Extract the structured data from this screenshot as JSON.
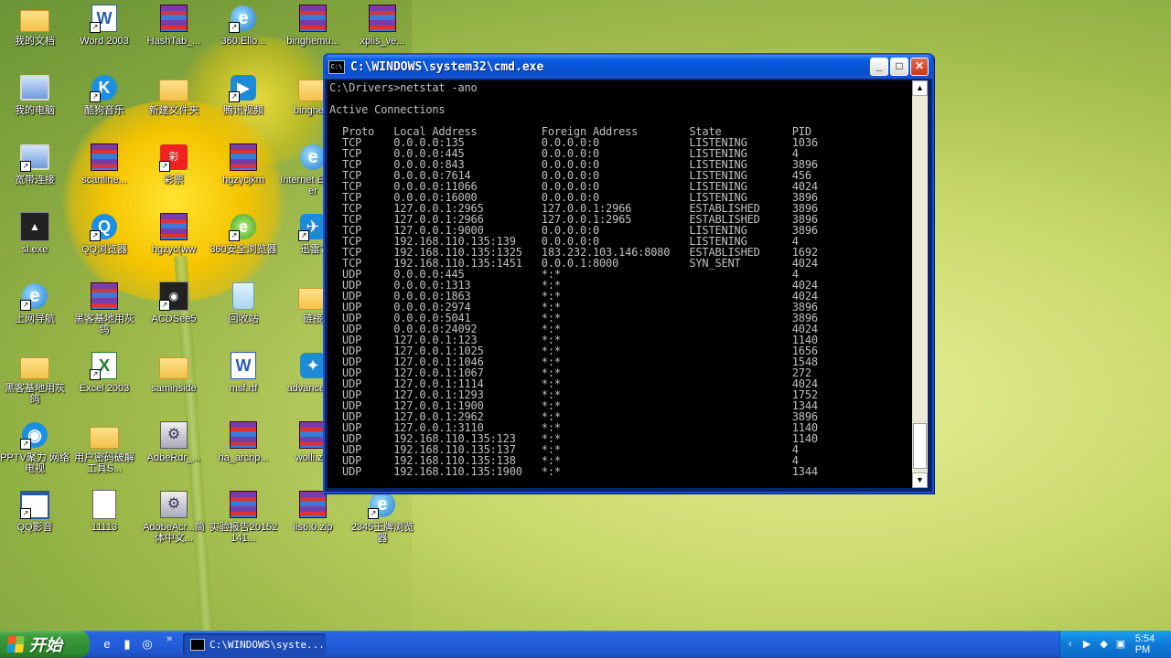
{
  "desktop_icons": [
    {
      "label": "我的文档",
      "icon": "folder-icon",
      "shortcut": false
    },
    {
      "label": "Word 2003",
      "icon": "word-icon",
      "shortcut": true
    },
    {
      "label": "HashTab_...",
      "icon": "archive-icon",
      "shortcut": false
    },
    {
      "label": "360.Ello...",
      "icon": "ie-icon",
      "shortcut": true
    },
    {
      "label": "binghemu...",
      "icon": "archive-icon",
      "shortcut": false
    },
    {
      "label": "xpiis_ve...",
      "icon": "archive-icon",
      "shortcut": false
    },
    {
      "label": "我的电脑",
      "icon": "computer-icon",
      "shortcut": false
    },
    {
      "label": "酷狗音乐",
      "icon": "kugou-icon",
      "shortcut": true
    },
    {
      "label": "新建文件夹",
      "icon": "folder-icon",
      "shortcut": false
    },
    {
      "label": "腾讯视频",
      "icon": "video-icon",
      "shortcut": true
    },
    {
      "label": "binghem",
      "icon": "folder-icon",
      "shortcut": false
    },
    {
      "label": "网上邻居",
      "icon": "network-icon",
      "shortcut": false
    },
    {
      "label": "宽带连接",
      "icon": "broadband-icon",
      "shortcut": true
    },
    {
      "label": "scanline...",
      "icon": "archive-icon",
      "shortcut": false
    },
    {
      "label": "彩票",
      "icon": "lottery-icon",
      "shortcut": true
    },
    {
      "label": "hgzycjkm",
      "icon": "archive-icon",
      "shortcut": false
    },
    {
      "label": "Internet Explorer",
      "icon": "ie-icon",
      "shortcut": false
    },
    {
      "label": "腾讯QQ",
      "icon": "qq-icon",
      "shortcut": true
    },
    {
      "label": "sl.exe",
      "icon": "exe-icon",
      "shortcut": false
    },
    {
      "label": "QQ浏览器",
      "icon": "browser-icon",
      "shortcut": true
    },
    {
      "label": "hgzyc(ww",
      "icon": "archive-icon",
      "shortcut": false
    },
    {
      "label": "360安全浏览器",
      "icon": "browser-360-icon",
      "shortcut": true
    },
    {
      "label": "迅雷7",
      "icon": "thunder-icon",
      "shortcut": true
    },
    {
      "label": "nmap-7.6...",
      "icon": "setup-icon",
      "shortcut": false
    },
    {
      "label": "上网导航",
      "icon": "ie-icon",
      "shortcut": true
    },
    {
      "label": "黑客基地用灰鸽",
      "icon": "archive-icon",
      "shortcut": false
    },
    {
      "label": "ACDSee5",
      "icon": "acdsee-icon",
      "shortcut": true
    },
    {
      "label": "回收站",
      "icon": "recycle-bin-icon",
      "shortcut": false
    },
    {
      "label": "链接",
      "icon": "folder-icon",
      "shortcut": false
    },
    {
      "label": "实验报告20152141...",
      "icon": "pdf-icon",
      "shortcut": false
    },
    {
      "label": "黑客基地用灰鸽",
      "icon": "folder-icon",
      "shortcut": false
    },
    {
      "label": "Excel 2003",
      "icon": "excel-icon",
      "shortcut": true
    },
    {
      "label": "saminside",
      "icon": "folder-icon",
      "shortcut": false
    },
    {
      "label": "msf.rtf",
      "icon": "document-icon",
      "shortcut": false
    },
    {
      "label": "advanced...",
      "icon": "app-icon",
      "shortcut": false
    },
    {
      "label": "WinHex15",
      "icon": "folder-icon",
      "shortcut": false
    },
    {
      "label": "PPTV聚力 网络电视",
      "icon": "pptv-icon",
      "shortcut": true
    },
    {
      "label": "用户密码破解工具S...",
      "icon": "folder-icon",
      "shortcut": false
    },
    {
      "label": "AdbeRdr_...",
      "icon": "setup-icon",
      "shortcut": false
    },
    {
      "label": "ha_archp...",
      "icon": "archive-icon",
      "shortcut": false
    },
    {
      "label": "wolli.zip",
      "icon": "archive-icon",
      "shortcut": false
    },
    {
      "label": "acunetix...",
      "icon": "acunetix-icon",
      "shortcut": false
    },
    {
      "label": "QQ影音",
      "icon": "window-icon",
      "shortcut": true
    },
    {
      "label": "11113",
      "icon": "text-file-icon",
      "shortcut": false
    },
    {
      "label": "AdobeAcr...简体中文...",
      "icon": "setup-icon",
      "shortcut": false
    },
    {
      "label": "实验报告20152141...",
      "icon": "archive-icon",
      "shortcut": false
    },
    {
      "label": "iis6.0.zip",
      "icon": "archive-icon",
      "shortcut": false
    },
    {
      "label": "2345王牌浏览器",
      "icon": "ie-icon",
      "shortcut": true
    }
  ],
  "cmd_window": {
    "title": "C:\\WINDOWS\\system32\\cmd.exe",
    "icon_text": "C:\\",
    "minimize": "_",
    "maximize": "□",
    "close": "✕",
    "prompt": "C:\\Drivers>netstat -ano",
    "heading": "Active Connections",
    "columns": [
      "Proto",
      "Local Address",
      "Foreign Address",
      "State",
      "PID"
    ],
    "rows": [
      [
        "TCP",
        "0.0.0.0:135",
        "0.0.0.0:0",
        "LISTENING",
        "1036"
      ],
      [
        "TCP",
        "0.0.0.0:445",
        "0.0.0.0:0",
        "LISTENING",
        "4"
      ],
      [
        "TCP",
        "0.0.0.0:843",
        "0.0.0.0:0",
        "LISTENING",
        "3896"
      ],
      [
        "TCP",
        "0.0.0.0:7614",
        "0.0.0.0:0",
        "LISTENING",
        "456"
      ],
      [
        "TCP",
        "0.0.0.0:11066",
        "0.0.0.0:0",
        "LISTENING",
        "4024"
      ],
      [
        "TCP",
        "0.0.0.0:16000",
        "0.0.0.0:0",
        "LISTENING",
        "3896"
      ],
      [
        "TCP",
        "127.0.0.1:2965",
        "127.0.0.1:2966",
        "ESTABLISHED",
        "3896"
      ],
      [
        "TCP",
        "127.0.0.1:2966",
        "127.0.0.1:2965",
        "ESTABLISHED",
        "3896"
      ],
      [
        "TCP",
        "127.0.0.1:9000",
        "0.0.0.0:0",
        "LISTENING",
        "3896"
      ],
      [
        "TCP",
        "192.168.110.135:139",
        "0.0.0.0:0",
        "LISTENING",
        "4"
      ],
      [
        "TCP",
        "192.168.110.135:1325",
        "183.232.103.146:8080",
        "ESTABLISHED",
        "1692"
      ],
      [
        "TCP",
        "192.168.110.135:1451",
        "0.0.0.1:8000",
        "SYN_SENT",
        "4024"
      ],
      [
        "UDP",
        "0.0.0.0:445",
        "*:*",
        "",
        "4"
      ],
      [
        "UDP",
        "0.0.0.0:1313",
        "*:*",
        "",
        "4024"
      ],
      [
        "UDP",
        "0.0.0.0:1863",
        "*:*",
        "",
        "4024"
      ],
      [
        "UDP",
        "0.0.0.0:2974",
        "*:*",
        "",
        "3896"
      ],
      [
        "UDP",
        "0.0.0.0:5041",
        "*:*",
        "",
        "3896"
      ],
      [
        "UDP",
        "0.0.0.0:24092",
        "*:*",
        "",
        "4024"
      ],
      [
        "UDP",
        "127.0.0.1:123",
        "*:*",
        "",
        "1140"
      ],
      [
        "UDP",
        "127.0.0.1:1025",
        "*:*",
        "",
        "1656"
      ],
      [
        "UDP",
        "127.0.0.1:1046",
        "*:*",
        "",
        "1548"
      ],
      [
        "UDP",
        "127.0.0.1:1067",
        "*:*",
        "",
        "272"
      ],
      [
        "UDP",
        "127.0.0.1:1114",
        "*:*",
        "",
        "4024"
      ],
      [
        "UDP",
        "127.0.0.1:1293",
        "*:*",
        "",
        "1752"
      ],
      [
        "UDP",
        "127.0.0.1:1900",
        "*:*",
        "",
        "1344"
      ],
      [
        "UDP",
        "127.0.0.1:2962",
        "*:*",
        "",
        "3896"
      ],
      [
        "UDP",
        "127.0.0.1:3110",
        "*:*",
        "",
        "1140"
      ],
      [
        "UDP",
        "192.168.110.135:123",
        "*:*",
        "",
        "1140"
      ],
      [
        "UDP",
        "192.168.110.135:137",
        "*:*",
        "",
        "4"
      ],
      [
        "UDP",
        "192.168.110.135:138",
        "*:*",
        "",
        "4"
      ],
      [
        "UDP",
        "192.168.110.135:1900",
        "*:*",
        "",
        "1344"
      ]
    ]
  },
  "taskbar": {
    "start_label": "开始",
    "task_button": "C:\\WINDOWS\\syste...",
    "quick_launch_more": "»",
    "clock": "5:54 PM"
  },
  "colors": {
    "taskbar_blue": "#245edb",
    "start_green": "#3c9c3c",
    "console_text": "#c0c0c0"
  }
}
